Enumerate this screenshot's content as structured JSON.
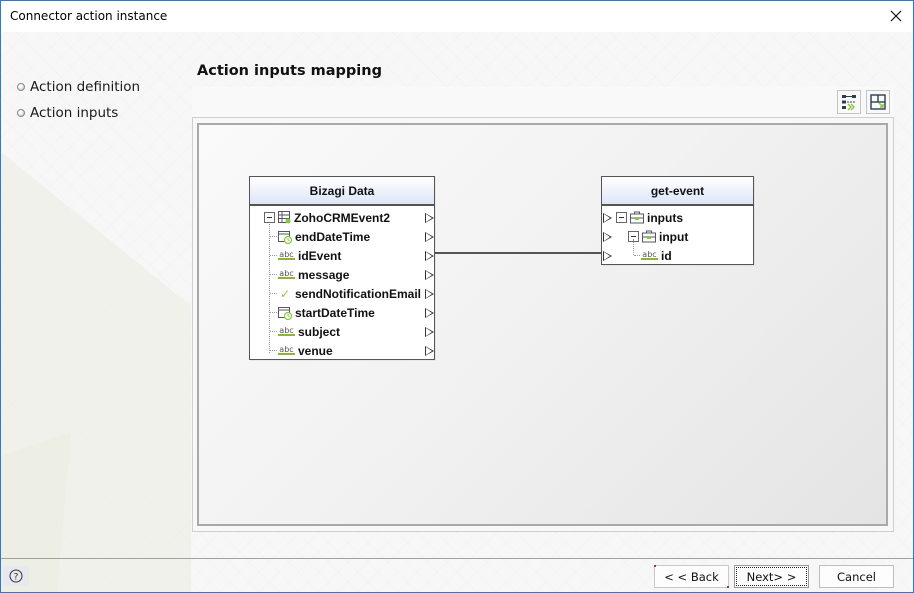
{
  "window": {
    "title": "Connector action instance",
    "close_icon": "close-icon"
  },
  "nav": {
    "items": [
      {
        "label": "Action definition",
        "icon": "radio-bullet-icon"
      },
      {
        "label": "Action inputs",
        "icon": "radio-bullet-icon"
      }
    ]
  },
  "main": {
    "section_title": "Action inputs mapping",
    "toolbar": {
      "buttons": [
        {
          "name": "auto-map",
          "icon": "auto-map-icon"
        },
        {
          "name": "layout",
          "icon": "layout-icon"
        }
      ]
    }
  },
  "mapping": {
    "source": {
      "title": "Bizagi Data",
      "items": [
        {
          "label": "ZohoCRMEvent2",
          "icon": "entity-icon",
          "expandable": true
        },
        {
          "label": "endDateTime",
          "icon": "datetime-icon"
        },
        {
          "label": "idEvent",
          "icon": "string-icon",
          "icon_text": "abc"
        },
        {
          "label": "message",
          "icon": "string-icon",
          "icon_text": "abc"
        },
        {
          "label": "sendNotificationEmail",
          "icon": "boolean-icon",
          "icon_text": "✓"
        },
        {
          "label": "startDateTime",
          "icon": "datetime-icon"
        },
        {
          "label": "subject",
          "icon": "string-icon",
          "icon_text": "abc"
        },
        {
          "label": "venue",
          "icon": "string-icon",
          "icon_text": "abc"
        }
      ]
    },
    "target": {
      "title": "get-event",
      "items": [
        {
          "label": "inputs",
          "icon": "object-icon",
          "expandable": true
        },
        {
          "label": "input",
          "icon": "object-icon",
          "expandable": true
        },
        {
          "label": "id",
          "icon": "string-icon",
          "icon_text": "abc"
        }
      ]
    },
    "connections": [
      {
        "from": "idEvent",
        "to": "id"
      }
    ]
  },
  "footer": {
    "help_icon": "help-icon",
    "back_label": "< < Back",
    "next_label": "Next> >",
    "cancel_label": "Cancel"
  }
}
